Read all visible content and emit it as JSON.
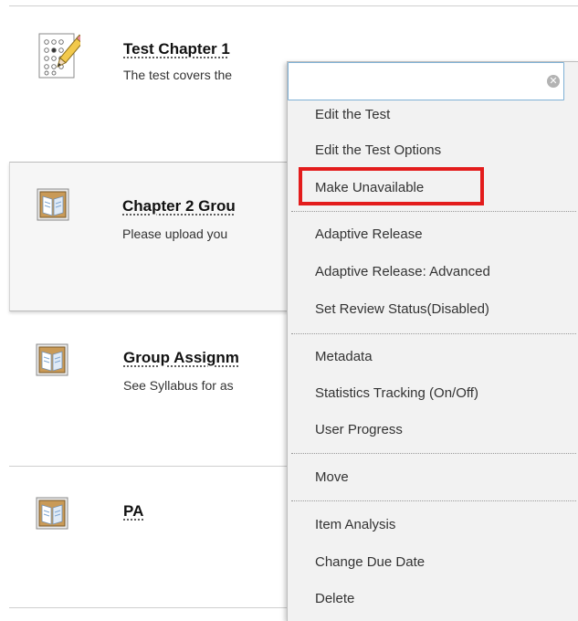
{
  "items": [
    {
      "title": "Test Chapter 1",
      "description": "The test covers the",
      "icon": "test-icon"
    },
    {
      "title": "Chapter 2 Grou",
      "description": "Please upload you",
      "icon": "assignment-icon"
    },
    {
      "title": "Group Assignm",
      "description": "See Syllabus for as",
      "icon": "assignment-icon"
    },
    {
      "title": "PA",
      "description": "",
      "icon": "assignment-icon"
    }
  ],
  "menu": {
    "close_icon": "close-icon",
    "items": [
      "Edit the Test",
      "Edit the Test Options",
      "Make Unavailable",
      "Adaptive Release",
      "Adaptive Release: Advanced",
      "Set Review Status(Disabled)",
      "Metadata",
      "Statistics Tracking (On/Off)",
      "User Progress",
      "Move",
      "Item Analysis",
      "Change Due Date",
      "Delete"
    ],
    "highlighted": "Make Unavailable",
    "highlight_color": "#e31c1c"
  }
}
